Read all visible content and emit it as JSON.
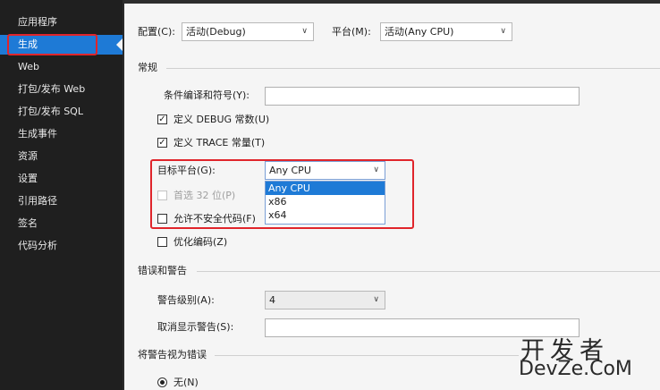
{
  "sidebar": {
    "items": [
      {
        "label": "应用程序"
      },
      {
        "label": "生成"
      },
      {
        "label": "Web"
      },
      {
        "label": "打包/发布 Web"
      },
      {
        "label": "打包/发布 SQL"
      },
      {
        "label": "生成事件"
      },
      {
        "label": "资源"
      },
      {
        "label": "设置"
      },
      {
        "label": "引用路径"
      },
      {
        "label": "签名"
      },
      {
        "label": "代码分析"
      }
    ],
    "active_index": 1
  },
  "toolbar": {
    "config_label": "配置(C):",
    "config_value": "活动(Debug)",
    "platform_label": "平台(M):",
    "platform_value": "活动(Any CPU)"
  },
  "general": {
    "title": "常规",
    "symbols_label": "条件编译和符号(Y):",
    "symbols_value": "",
    "define_debug": {
      "label": "定义 DEBUG 常数(U)",
      "checked": true
    },
    "define_trace": {
      "label": "定义 TRACE 常量(T)",
      "checked": true
    },
    "target_label": "目标平台(G):",
    "target_value": "Any CPU",
    "target_options": [
      "Any CPU",
      "x86",
      "x64"
    ],
    "prefer32": {
      "label": "首选 32 位(P)",
      "checked": false,
      "disabled": true
    },
    "unsafe": {
      "label": "允许不安全代码(F)",
      "checked": false
    },
    "optimize": {
      "label": "优化编码(Z)",
      "checked": false
    }
  },
  "errors": {
    "title": "错误和警告",
    "warn_level_label": "警告级别(A):",
    "warn_level_value": "4",
    "suppress_label": "取消显示警告(S):",
    "suppress_value": ""
  },
  "treat_warnings": {
    "title": "将警告视为错误",
    "none_label": "无(N)"
  },
  "watermark": {
    "line1": "开发者",
    "line2": "DevZe.CoM"
  },
  "colors": {
    "accent": "#1e7ad6",
    "highlight_box": "#e0252b",
    "sidebar_bg": "#1f1f1f"
  }
}
